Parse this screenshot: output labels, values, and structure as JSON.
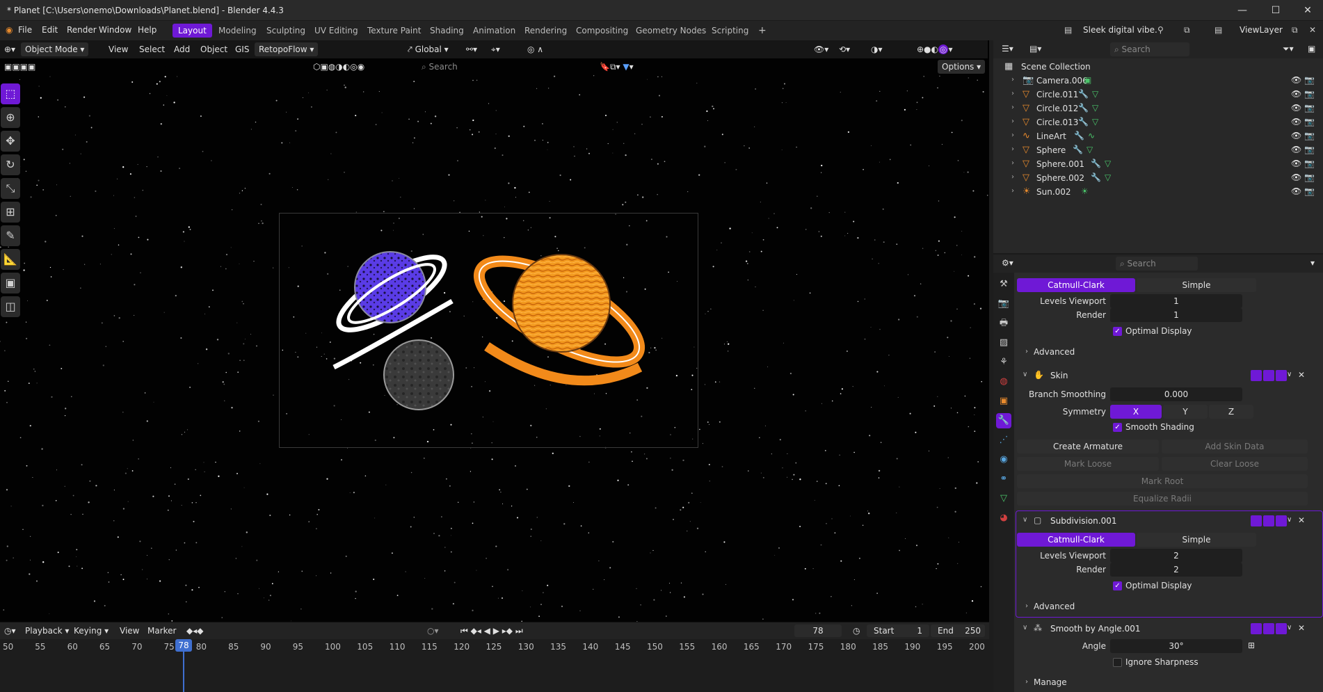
{
  "window": {
    "title": "* Planet [C:\\Users\\onemo\\Downloads\\Planet.blend] - Blender 4.4.3"
  },
  "menu": [
    "File",
    "Edit",
    "Render",
    "Window",
    "Help"
  ],
  "workspaces": [
    "Layout",
    "Modeling",
    "Sculpting",
    "UV Editing",
    "Texture Paint",
    "Shading",
    "Animation",
    "Rendering",
    "Compositing",
    "Geometry Nodes",
    "Scripting"
  ],
  "top_right": {
    "scene": "Sleek digital vibe.",
    "view_layer": "ViewLayer"
  },
  "viewport": {
    "mode": "Object Mode",
    "menus": [
      "View",
      "Select",
      "Add",
      "Object",
      "GIS",
      "RetopoFlow"
    ],
    "transform": "Global",
    "search_placeholder": "Search",
    "options": "Options"
  },
  "outliner": {
    "search_placeholder": "Search",
    "collection": "Scene Collection",
    "items": [
      "Camera.006",
      "Circle.011",
      "Circle.012",
      "Circle.013",
      "LineArt",
      "Sphere",
      "Sphere.001",
      "Sphere.002",
      "Sun.002"
    ]
  },
  "properties": {
    "search_placeholder": "Search",
    "sub0": {
      "catmull": "Catmull-Clark",
      "simple": "Simple",
      "levels_label": "Levels Viewport",
      "levels": "1",
      "render_label": "Render",
      "render": "1",
      "optimal": "Optimal Display",
      "advanced": "Advanced"
    },
    "skin": {
      "name": "Skin",
      "branch_label": "Branch Smoothing",
      "branch": "0.000",
      "sym_label": "Symmetry",
      "x": "X",
      "y": "Y",
      "z": "Z",
      "smooth": "Smooth Shading",
      "create_armature": "Create Armature",
      "add_skin": "Add Skin Data",
      "mark_loose": "Mark Loose",
      "clear_loose": "Clear Loose",
      "mark_root": "Mark Root",
      "equalize": "Equalize Radii"
    },
    "sub1": {
      "name": "Subdivision.001",
      "catmull": "Catmull-Clark",
      "simple": "Simple",
      "levels_label": "Levels Viewport",
      "levels": "2",
      "render_label": "Render",
      "render": "2",
      "optimal": "Optimal Display",
      "advanced": "Advanced"
    },
    "smooth": {
      "name": "Smooth by Angle.001",
      "angle_label": "Angle",
      "angle": "30°",
      "ignore": "Ignore Sharpness",
      "manage": "Manage"
    }
  },
  "timeline": {
    "menus": [
      "Playback",
      "Keying",
      "View",
      "Marker"
    ],
    "current": "78",
    "start_label": "Start",
    "start": "1",
    "end_label": "End",
    "end": "250",
    "ticks": [
      "50",
      "55",
      "60",
      "65",
      "70",
      "75",
      "80",
      "85",
      "90",
      "95",
      "100",
      "105",
      "110",
      "115",
      "120",
      "125",
      "130",
      "135",
      "140",
      "145",
      "150",
      "155",
      "160",
      "165",
      "170",
      "175",
      "180",
      "185",
      "190",
      "195",
      "200"
    ]
  },
  "colors": {
    "accent": "#6f19d6",
    "playhead": "#3f6fd0",
    "object_orange": "#e78a2d"
  }
}
